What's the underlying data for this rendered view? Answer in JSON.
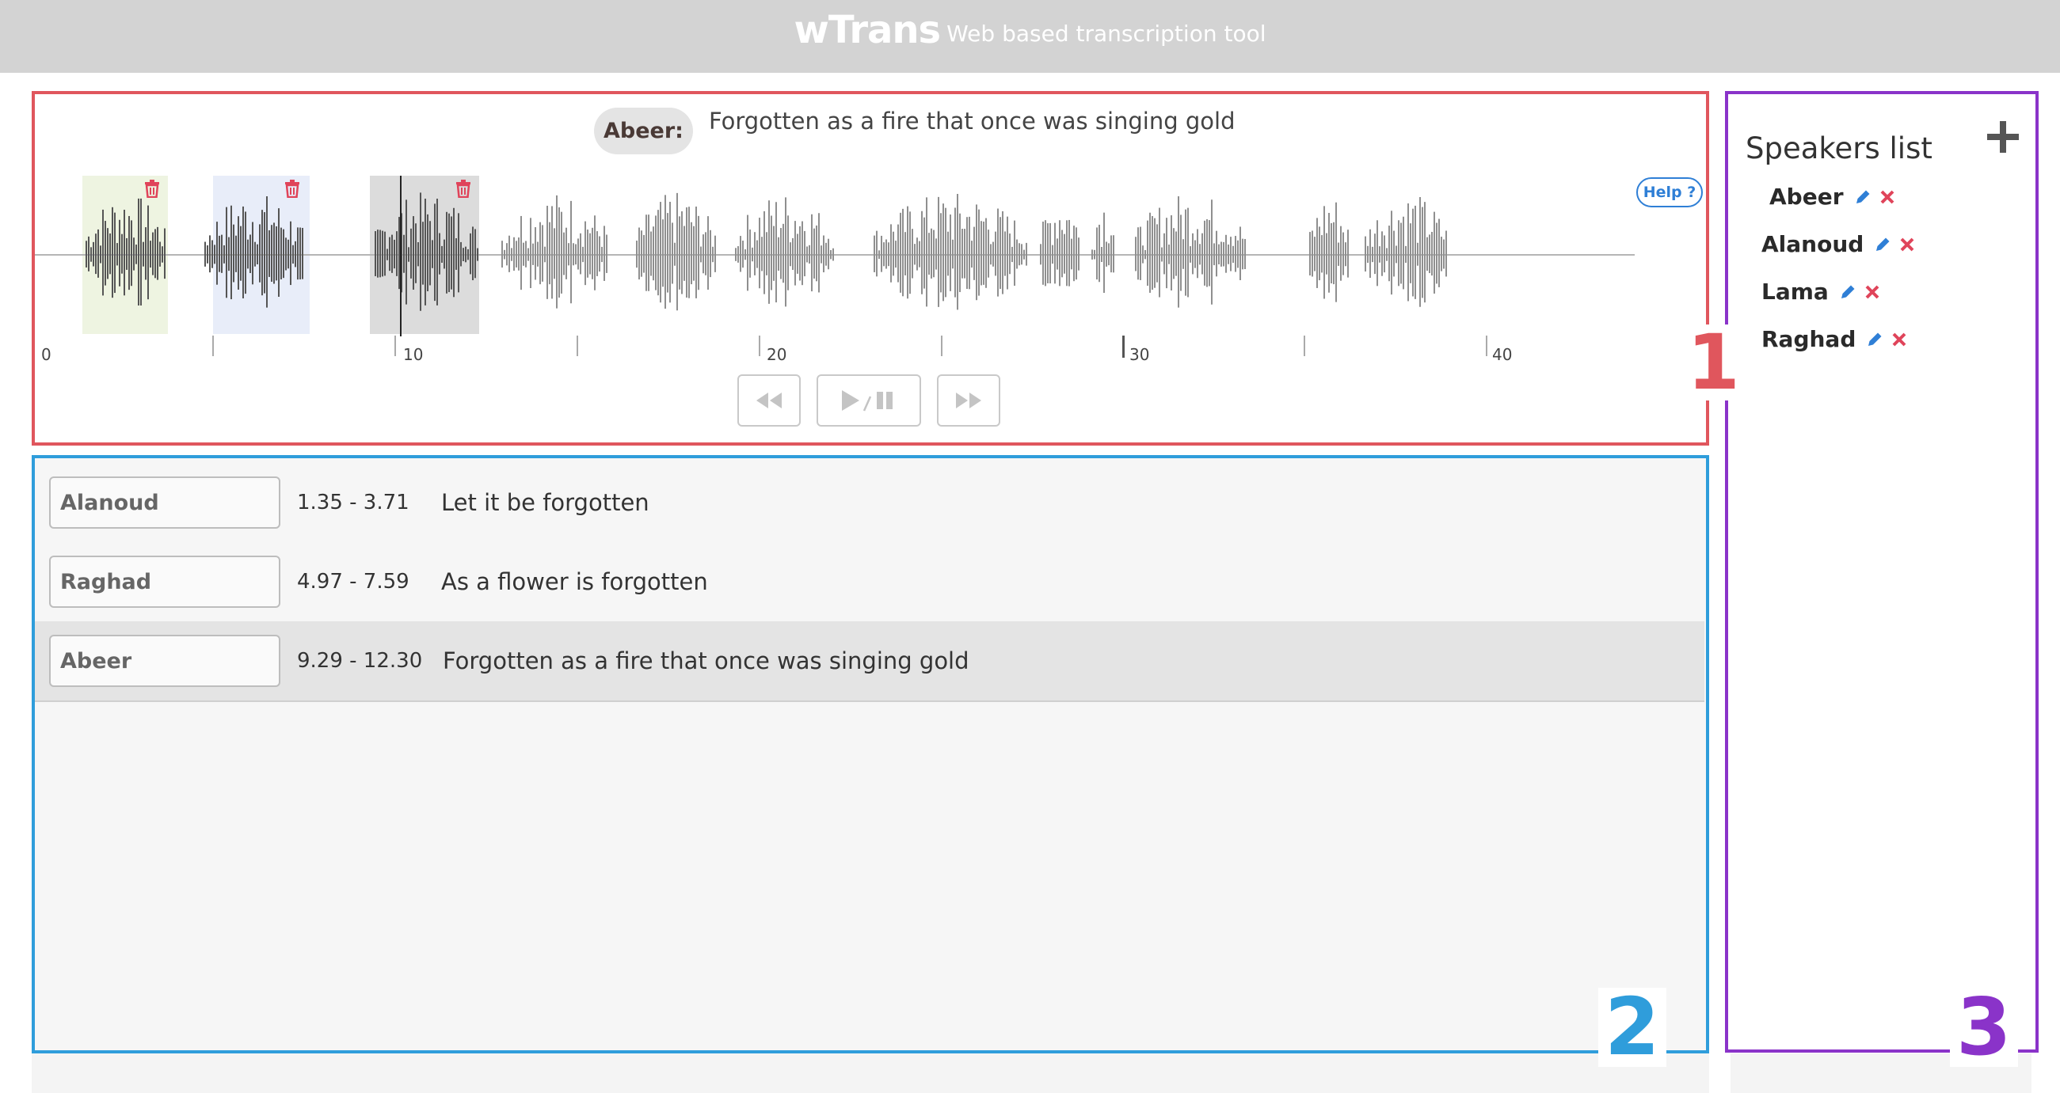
{
  "header": {
    "logo": "wTrans",
    "tagline": "Web based transcription tool"
  },
  "player": {
    "current_speaker": "Abeer:",
    "current_text": "Forgotten as a fire that once was singing gold",
    "help_label": "Help ?",
    "timeline_labels": [
      "0",
      "10",
      "20",
      "30",
      "40"
    ]
  },
  "transcript": [
    {
      "speaker": "Alanoud",
      "time": "1.35 - 3.71",
      "text": "Let it be forgotten"
    },
    {
      "speaker": "Raghad",
      "time": "4.97 - 7.59",
      "text": "As a flower is forgotten"
    },
    {
      "speaker": "Abeer",
      "time": "9.29 - 12.30",
      "text": "Forgotten as a fire that once was singing gold"
    }
  ],
  "speakers_panel": {
    "title": "Speakers list",
    "speakers": [
      "Abeer",
      "Alanoud",
      "Lama",
      "Raghad"
    ]
  },
  "annotations": {
    "panel1": "1",
    "panel2": "2",
    "panel3": "3"
  },
  "colors": {
    "panel1": "#e0565d",
    "panel2": "#2f9ddb",
    "panel3": "#8a33c9",
    "edit": "#2f7fd6",
    "delete": "#e0445a"
  }
}
